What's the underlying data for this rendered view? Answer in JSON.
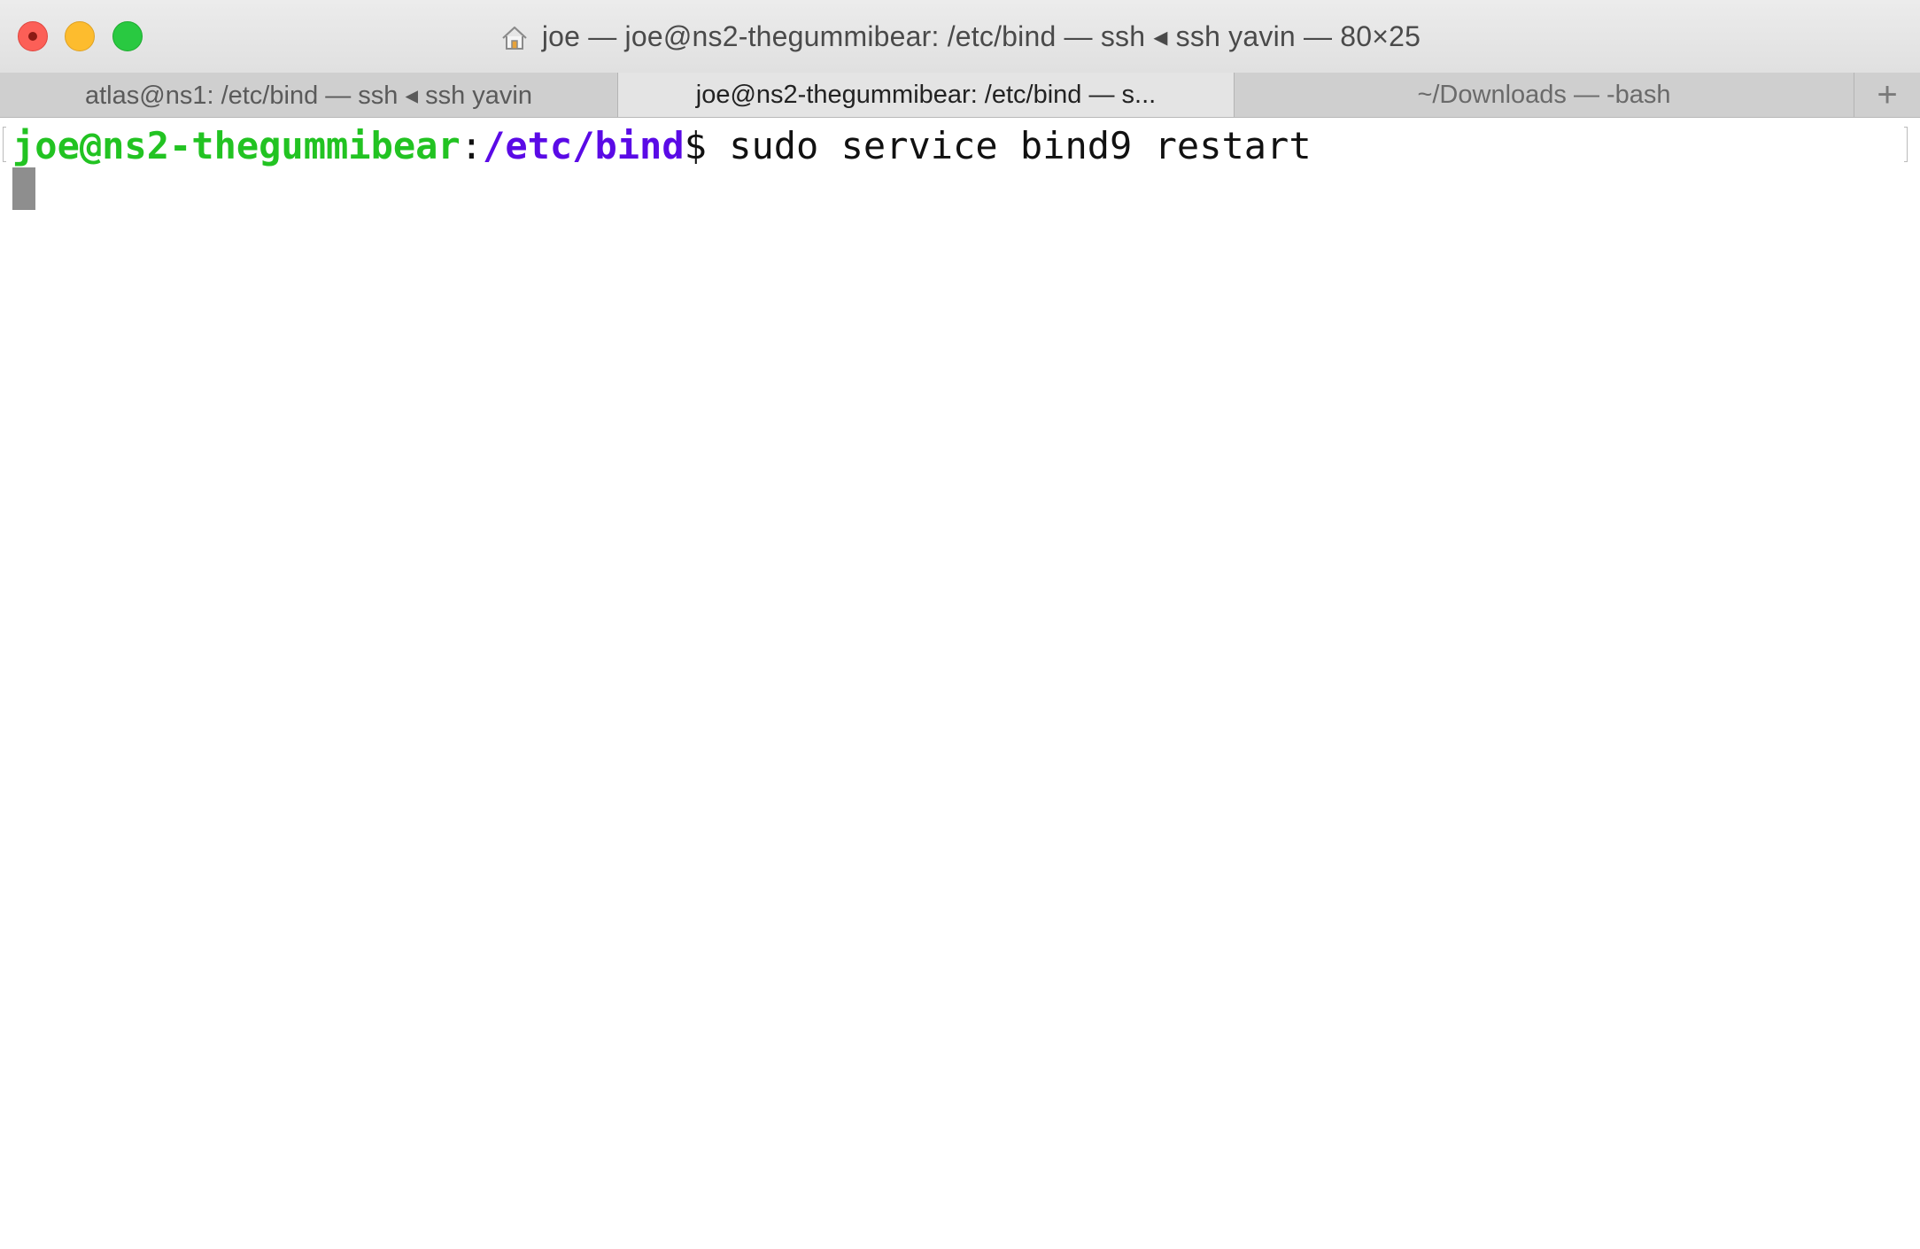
{
  "window": {
    "title": "joe — joe@ns2-thegummibear: /etc/bind — ssh ◂ ssh yavin — 80×25",
    "title_icon": "home-icon",
    "traffic_lights": {
      "close_color": "#fc5f57",
      "minimize_color": "#fdbc2e",
      "zoom_color": "#29c941"
    }
  },
  "tabs": [
    {
      "label": "atlas@ns1: /etc/bind — ssh ◂ ssh yavin",
      "active": false
    },
    {
      "label": "joe@ns2-thegummibear: /etc/bind — s...",
      "active": true
    },
    {
      "label": "~/Downloads — -bash",
      "active": false
    }
  ],
  "tab_add_label": "+",
  "terminal": {
    "prompt_user_host": "joe@ns2-thegummibear",
    "prompt_separator": ":",
    "prompt_path": "/etc/bind",
    "prompt_symbol": "$",
    "command": " sudo service bind9 restart",
    "colors": {
      "user_host": "#22c322",
      "path": "#5a0ae6",
      "cursor": "#8e8e8e"
    }
  }
}
